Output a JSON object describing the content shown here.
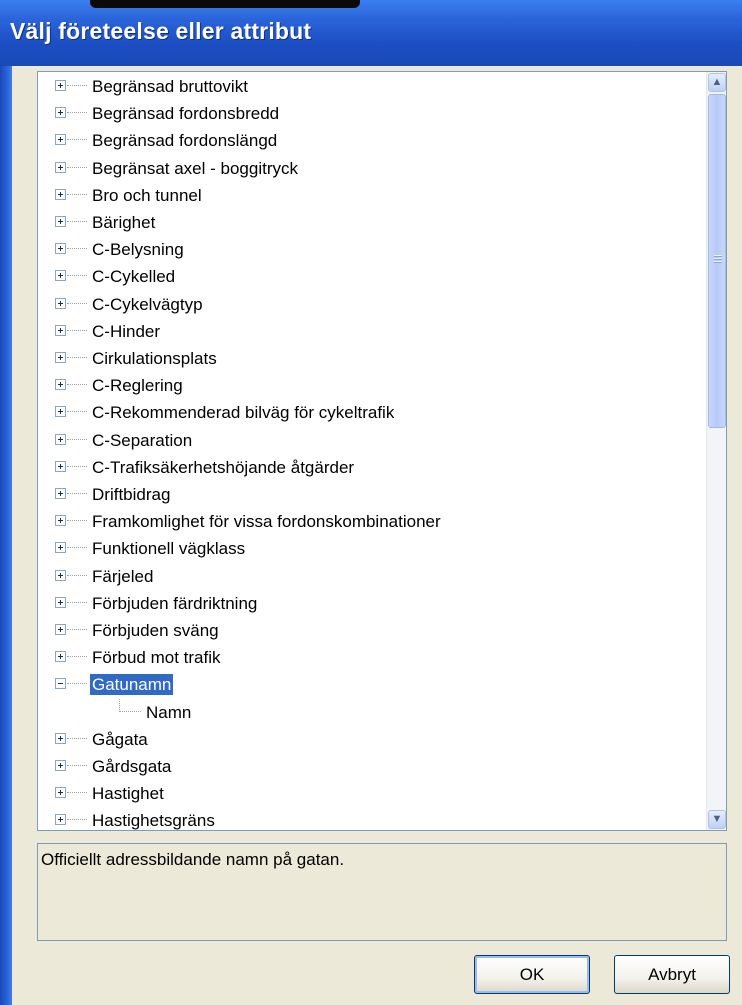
{
  "window": {
    "title": "Välj företeelse eller attribut"
  },
  "tree": {
    "items": [
      {
        "label": "Begränsad bruttovikt",
        "expander": "plus"
      },
      {
        "label": "Begränsad fordonsbredd",
        "expander": "plus"
      },
      {
        "label": "Begränsad fordonslängd",
        "expander": "plus"
      },
      {
        "label": "Begränsat axel - boggitryck",
        "expander": "plus"
      },
      {
        "label": "Bro och tunnel",
        "expander": "plus"
      },
      {
        "label": "Bärighet",
        "expander": "plus"
      },
      {
        "label": "C-Belysning",
        "expander": "plus"
      },
      {
        "label": "C-Cykelled",
        "expander": "plus"
      },
      {
        "label": "C-Cykelvägtyp",
        "expander": "plus"
      },
      {
        "label": "C-Hinder",
        "expander": "plus"
      },
      {
        "label": "Cirkulationsplats",
        "expander": "plus"
      },
      {
        "label": "C-Reglering",
        "expander": "plus"
      },
      {
        "label": "C-Rekommenderad bilväg för cykeltrafik",
        "expander": "plus"
      },
      {
        "label": "C-Separation",
        "expander": "plus"
      },
      {
        "label": "C-Trafiksäkerhetshöjande åtgärder",
        "expander": "plus"
      },
      {
        "label": "Driftbidrag",
        "expander": "plus"
      },
      {
        "label": "Framkomlighet för vissa fordonskombinationer",
        "expander": "plus"
      },
      {
        "label": "Funktionell vägklass",
        "expander": "plus"
      },
      {
        "label": "Färjeled",
        "expander": "plus"
      },
      {
        "label": "Förbjuden färdriktning",
        "expander": "plus"
      },
      {
        "label": "Förbjuden sväng",
        "expander": "plus"
      },
      {
        "label": "Förbud mot trafik",
        "expander": "plus"
      },
      {
        "label": "Gatunamn",
        "expander": "minus",
        "selected": true
      },
      {
        "label": "Namn",
        "child": true
      },
      {
        "label": "Gågata",
        "expander": "plus"
      },
      {
        "label": "Gårdsgata",
        "expander": "plus"
      },
      {
        "label": "Hastighet",
        "expander": "plus"
      },
      {
        "label": "Hastighetsgräns",
        "expander": "plus"
      }
    ]
  },
  "description": {
    "text": "Officiellt adressbildande namn på gatan."
  },
  "buttons": {
    "ok_label": "OK",
    "cancel_label": "Avbryt"
  },
  "colors": {
    "title_bar": "#2a63d8",
    "selection": "#316ac5",
    "dialog_bg": "#ece9d8"
  },
  "icons": {
    "scroll_up": "chevron-up-icon",
    "scroll_down": "chevron-down-icon",
    "expand": "plus-box-icon",
    "collapse": "minus-box-icon"
  }
}
